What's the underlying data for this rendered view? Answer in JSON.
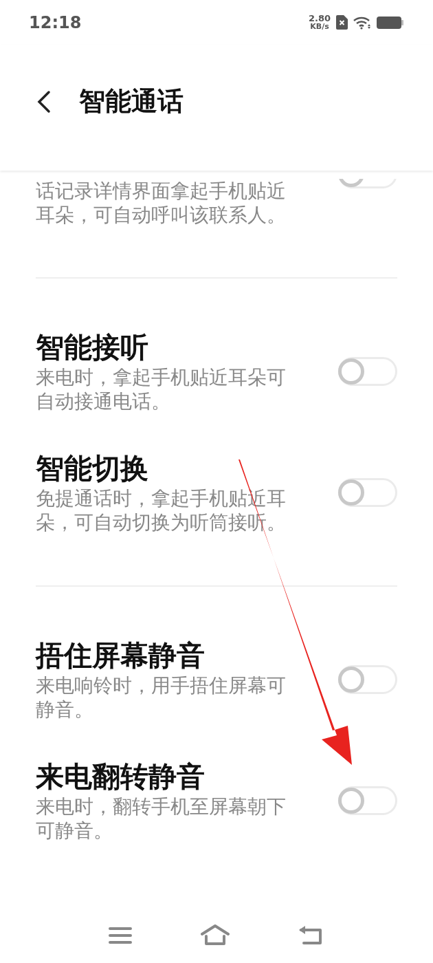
{
  "status_bar": {
    "time": "12:18",
    "speed_value": "2.80",
    "speed_unit": "KB/s"
  },
  "header": {
    "title": "智能通话"
  },
  "sections": [
    {
      "items": [
        {
          "description": "话记录详情界面拿起手机贴近耳朵，可自动呼叫该联系人。",
          "on": false,
          "kind": "partial"
        }
      ]
    },
    {
      "items": [
        {
          "title": "智能接听",
          "description": "来电时，拿起手机贴近耳朵可自动接通电话。",
          "on": false,
          "kind": "full"
        },
        {
          "title": "智能切换",
          "description": "免提通话时，拿起手机贴近耳朵，可自动切换为听筒接听。",
          "on": false,
          "kind": "full"
        }
      ]
    },
    {
      "items": [
        {
          "title": "捂住屏幕静音",
          "description": "来电响铃时，用手捂住屏幕可静音。",
          "on": false,
          "kind": "full"
        },
        {
          "title": "来电翻转静音",
          "description": "来电时，翻转手机至屏幕朝下可静音。",
          "on": false,
          "kind": "full"
        }
      ]
    }
  ]
}
